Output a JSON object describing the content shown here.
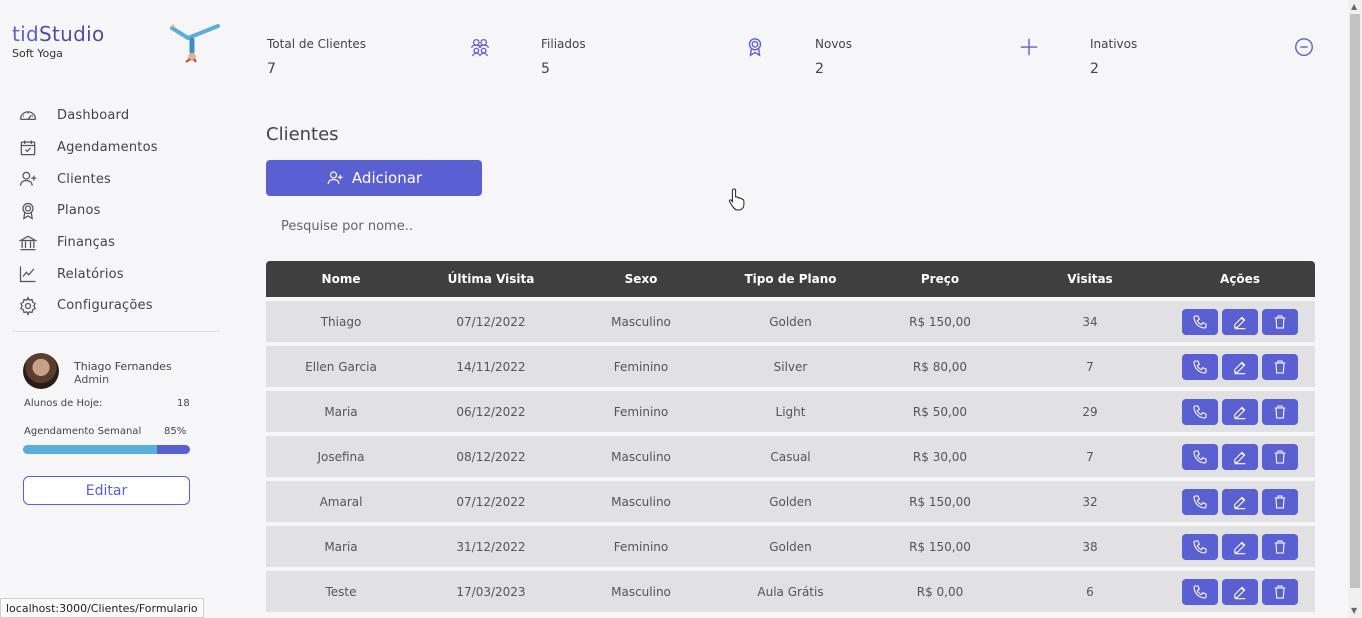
{
  "brand": {
    "name": "tidStudio",
    "subtitle": "Soft Yoga"
  },
  "nav": [
    {
      "label": "Dashboard",
      "icon": "gauge-icon"
    },
    {
      "label": "Agendamentos",
      "icon": "calendar-check-icon"
    },
    {
      "label": "Clientes",
      "icon": "user-plus-icon"
    },
    {
      "label": "Planos",
      "icon": "award-icon"
    },
    {
      "label": "Finanças",
      "icon": "bank-icon"
    },
    {
      "label": "Relatórios",
      "icon": "chart-line-icon"
    },
    {
      "label": "Configurações",
      "icon": "gear-icon"
    }
  ],
  "user": {
    "name": "Thiago Fernandes",
    "role": "Admin",
    "today_label": "Alunos de Hoje:",
    "today_value": "18",
    "weekly_label": "Agendamento Semanal",
    "weekly_value": "85%",
    "weekly_fraction": 0.8,
    "edit_label": "Editar"
  },
  "stats": [
    {
      "label": "Total de Clientes",
      "value": "7",
      "icon": "users-icon"
    },
    {
      "label": "Filiados",
      "value": "5",
      "icon": "medal-icon"
    },
    {
      "label": "Novos",
      "value": "2",
      "icon": "plus-icon"
    },
    {
      "label": "Inativos",
      "value": "2",
      "icon": "minus-circle-icon"
    }
  ],
  "section_title": "Clientes",
  "add_label": "Adicionar",
  "search_placeholder": "Pesquise por nome..",
  "table": {
    "headers": [
      "Nome",
      "Última Visita",
      "Sexo",
      "Tipo de Plano",
      "Preço",
      "Visitas",
      "Ações"
    ],
    "rows": [
      [
        "Thiago",
        "07/12/2022",
        "Masculino",
        "Golden",
        "R$ 150,00",
        "34"
      ],
      [
        "Ellen Garcia",
        "14/11/2022",
        "Feminino",
        "Silver",
        "R$ 80,00",
        "7"
      ],
      [
        "Maria",
        "06/12/2022",
        "Feminino",
        "Light",
        "R$ 50,00",
        "29"
      ],
      [
        "Josefina",
        "08/12/2022",
        "Masculino",
        "Casual",
        "R$ 30,00",
        "7"
      ],
      [
        "Amaral",
        "07/12/2022",
        "Masculino",
        "Golden",
        "R$ 150,00",
        "32"
      ],
      [
        "Maria",
        "31/12/2022",
        "Feminino",
        "Golden",
        "R$ 150,00",
        "38"
      ],
      [
        "Teste",
        "17/03/2023",
        "Masculino",
        "Aula Grátis",
        "R$ 0,00",
        "6"
      ]
    ]
  },
  "status_url": "localhost:3000/Clientes/Formulario",
  "colors": {
    "accent": "#5a5fd1",
    "header": "#3f3f3f",
    "row": "#e1e1e4",
    "progress": "#5aaede"
  }
}
